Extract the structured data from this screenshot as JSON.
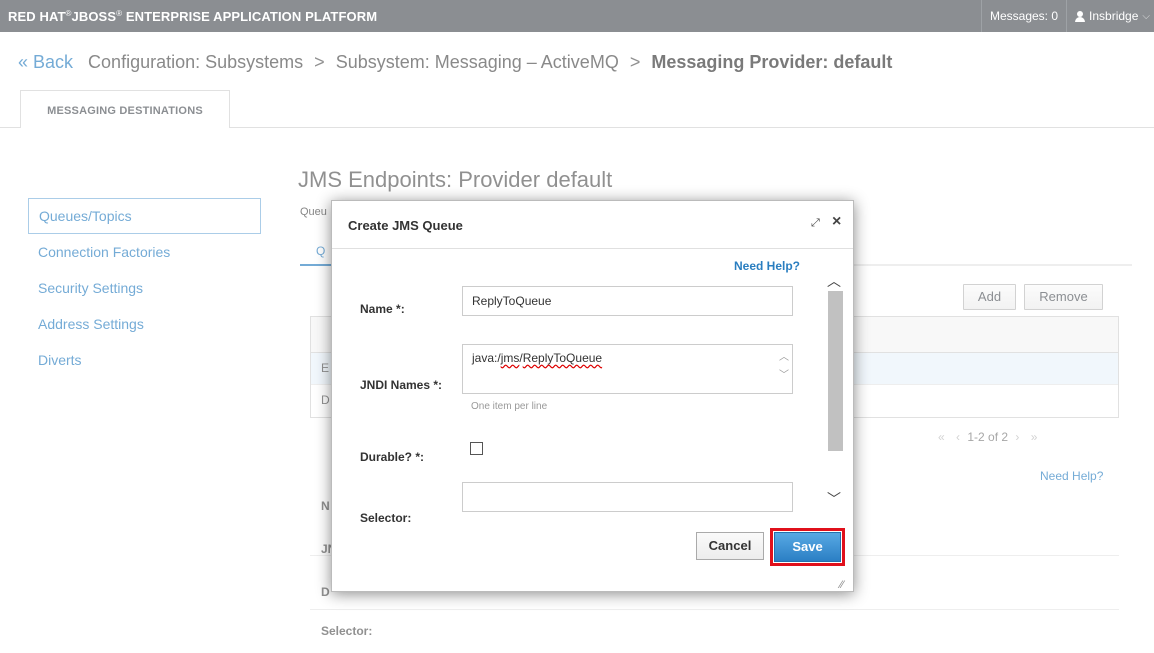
{
  "topbar": {
    "brand": "RED HAT JBOSS ENTERPRISE APPLICATION PLATFORM",
    "brand_part1": "RED HAT",
    "brand_part2": "JBOSS",
    "brand_part3": "ENTERPRISE APPLICATION PLATFORM",
    "messages": "Messages: 0",
    "user": "Insbridge"
  },
  "breadcrumb": {
    "back": "« Back",
    "items": [
      "Configuration: Subsystems",
      "Subsystem: Messaging – ActiveMQ"
    ],
    "current": "Messaging Provider: default",
    "separator": ">"
  },
  "tabs": {
    "active": "MESSAGING DESTINATIONS"
  },
  "sidebar": {
    "items": [
      {
        "label": "Queues/Topics"
      },
      {
        "label": "Connection Factories"
      },
      {
        "label": "Security Settings"
      },
      {
        "label": "Address Settings"
      },
      {
        "label": "Diverts"
      }
    ]
  },
  "main": {
    "title": "JMS Endpoints: Provider default",
    "sub": "Queu",
    "sub_tab": "Q",
    "add_label": "Add",
    "remove_label": "Remove",
    "row1": "E",
    "row2": "D",
    "pager": "1-2 of 2",
    "need_help": "Need Help?",
    "detail_labels": [
      "N",
      "JN",
      "D",
      "Selector:"
    ]
  },
  "dialog": {
    "title": "Create JMS Queue",
    "need_help": "Need Help?",
    "name_label": "Name *:",
    "name_value": "ReplyToQueue",
    "jndi_label": "JNDI Names *:",
    "jndi_prefix": "java:/",
    "jndi_jms": "jms",
    "jndi_sep": "/",
    "jndi_queue": "ReplyToQueue",
    "jndi_hint": "One item per line",
    "durable_label": "Durable? *:",
    "selector_label": "Selector:",
    "selector_value": "",
    "cancel_label": "Cancel",
    "save_label": "Save"
  },
  "colors": {
    "topbar": "#4d5258",
    "link": "#2a7ec0",
    "save_highlight": "#e0101b"
  }
}
